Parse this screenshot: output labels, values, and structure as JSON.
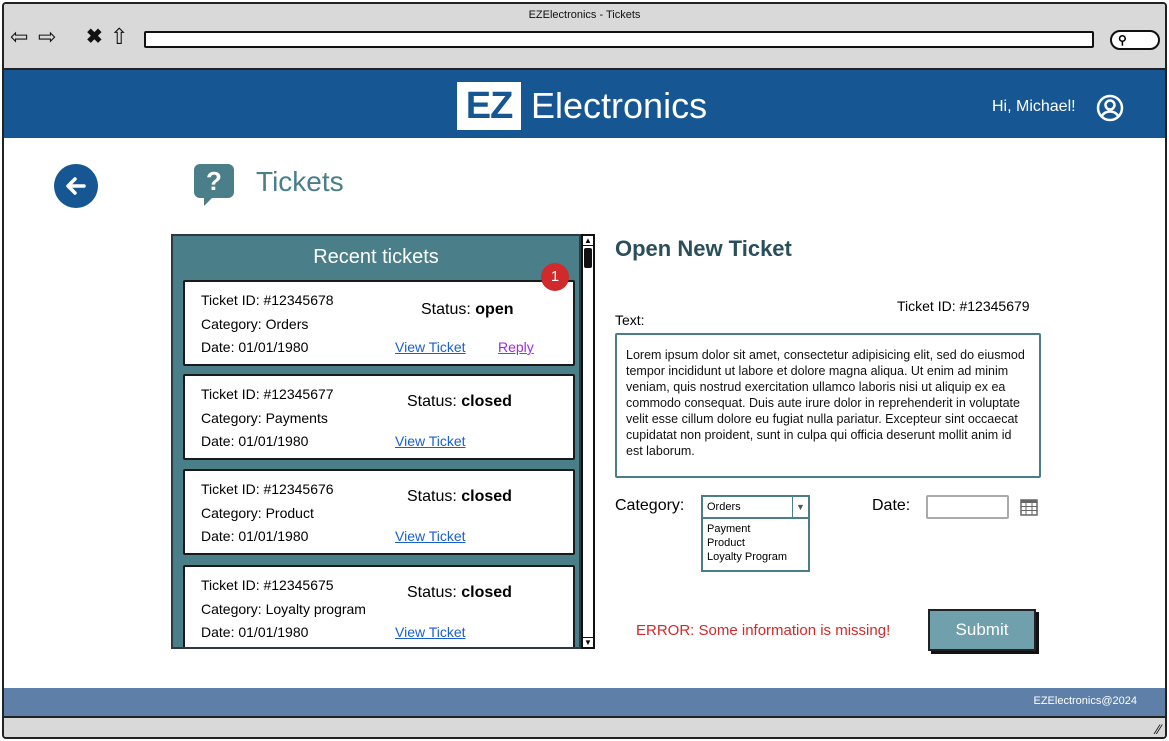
{
  "browser": {
    "title": "EZElectronics - Tickets"
  },
  "header": {
    "logo_box": "EZ",
    "logo_text": "Electronics",
    "greeting": "Hi, Michael!"
  },
  "page": {
    "title": "Tickets"
  },
  "recent": {
    "title": "Recent tickets",
    "badge": "1",
    "tickets": [
      {
        "id": "Ticket ID: #12345678",
        "category": "Category:  Orders",
        "date": "Date:  01/01/1980",
        "status_label": "Status:",
        "status": "open",
        "view": "View Ticket",
        "reply": "Reply"
      },
      {
        "id": "Ticket ID: #12345677",
        "category": "Category:  Payments",
        "date": "Date:  01/01/1980",
        "status_label": "Status:",
        "status": "closed",
        "view": "View Ticket"
      },
      {
        "id": "Ticket ID: #12345676",
        "category": "Category:  Product",
        "date": "Date:  01/01/1980",
        "status_label": "Status:",
        "status": "closed",
        "view": "View Ticket"
      },
      {
        "id": "Ticket ID: #12345675",
        "category": "Category:  Loyalty program",
        "date": "Date:  01/01/1980",
        "status_label": "Status:",
        "status": "closed",
        "view": "View Ticket"
      }
    ]
  },
  "form": {
    "title": "Open New Ticket",
    "ticket_id": "Ticket ID: #12345679",
    "text_label": "Text:",
    "text_value": "Lorem ipsum dolor sit amet, consectetur adipisicing elit, sed do eiusmod tempor incididunt ut labore et dolore magna aliqua. Ut enim ad minim veniam, quis nostrud exercitation ullamco laboris nisi ut aliquip ex ea commodo consequat. Duis aute irure dolor in reprehenderit in voluptate velit esse cillum dolore eu fugiat nulla pariatur. Excepteur sint occaecat cupidatat non proident, sunt in culpa qui officia deserunt mollit anim id est laborum.",
    "category_label": "Category:",
    "category_value": "Orders",
    "category_options": [
      "Payment",
      "Product",
      "Loyalty Program"
    ],
    "date_label": "Date:",
    "date_value": "",
    "error": "ERROR: Some information is missing!",
    "submit": "Submit"
  },
  "footer": {
    "text": "EZElectronics@2024"
  },
  "colors": {
    "header": "#165793",
    "panel": "#4a7f8a",
    "footer": "#5d7fa8",
    "error": "#d12a2a",
    "submit": "#6fa0ab"
  }
}
